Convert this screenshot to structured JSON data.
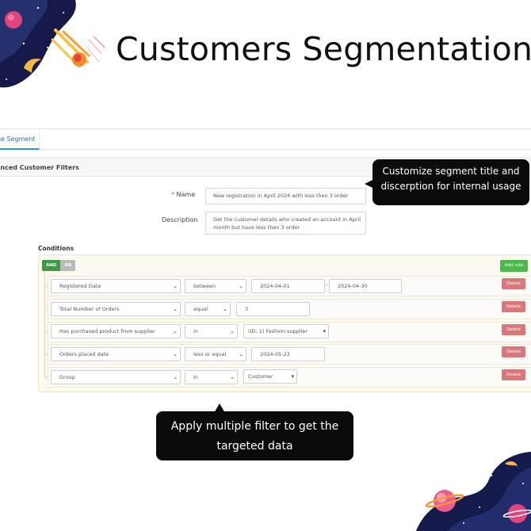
{
  "headline": "Customers Segmentation",
  "tab": {
    "label": "ge Segment"
  },
  "panel": {
    "title": "anced Customer Filters"
  },
  "form": {
    "name_label": "Name",
    "name_required_mark": "*",
    "name_value": "New registration in April 2024 with less then 3 order",
    "description_label": "Description",
    "description_line1": "Get the customer details who created an account in April",
    "description_line2": "month but have less then 3 order"
  },
  "conditions": {
    "label": "Conditions",
    "and_label": "AND",
    "or_label": "OR",
    "add_rule_label": "Add rule",
    "delete_label": "Delete",
    "rules": [
      {
        "field": "Registered Date",
        "operator": "between",
        "value1": "2024-04-01",
        "separator": "-",
        "value2": "2024-04-30"
      },
      {
        "field": "Total Number of Orders",
        "operator": "equal",
        "value1": "3"
      },
      {
        "field": "Has purchased product from supplier",
        "operator": "in",
        "value1": "(ID: 1) Fashion supplier"
      },
      {
        "field": "Orders placed date",
        "operator": "less or equal",
        "value1": "2024-05-23"
      },
      {
        "field": "Group",
        "operator": "in",
        "value1": "Customer"
      }
    ]
  },
  "callouts": {
    "title_tip_line1": "Customize segment title and",
    "title_tip_line2": "discerption for internal usage",
    "filter_tip_line1": "Apply multiple filter to get the",
    "filter_tip_line2": "targeted data"
  },
  "colors": {
    "and_green": "#3c9a42",
    "add_rule_green": "#4fb54f",
    "delete_red": "#d9777a",
    "tab_accent": "#2b9ed1"
  },
  "icons": {
    "select_arrow": "chevron-down-icon",
    "decoration_top": "rocket-planet-illustration",
    "decoration_bottom": "planets-illustration"
  }
}
